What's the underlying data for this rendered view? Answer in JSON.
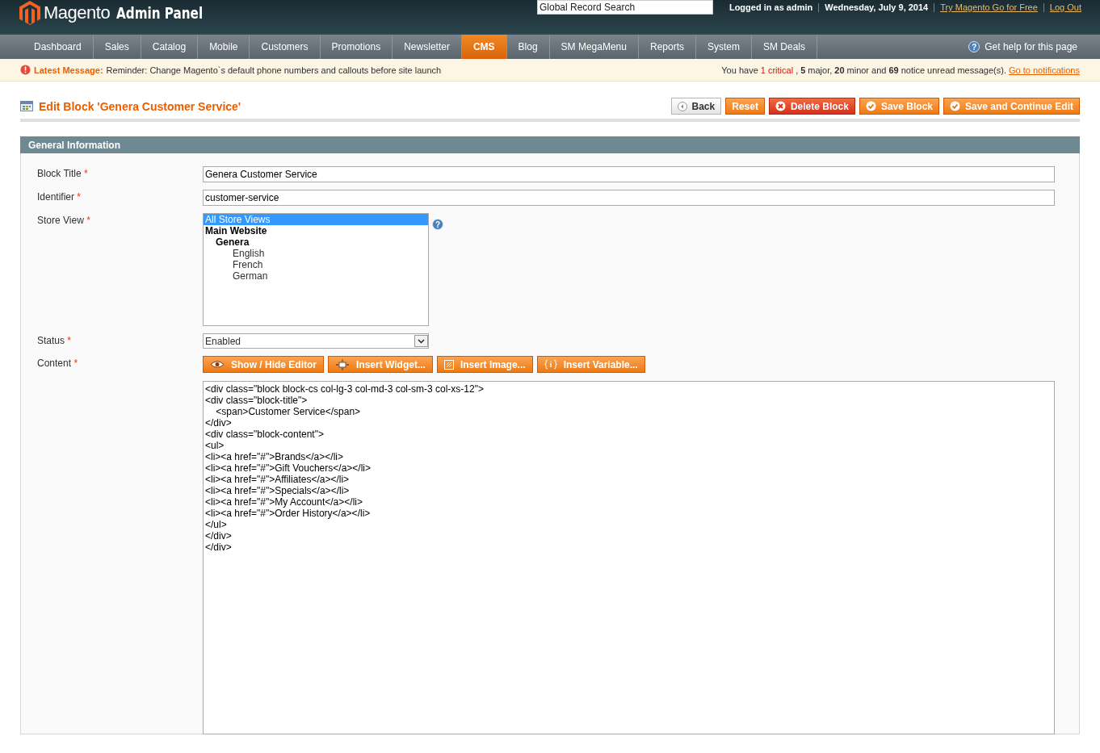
{
  "header": {
    "logo": "Magento",
    "logo_sub": "Admin Panel",
    "search": {
      "placeholder": "Global Record Search"
    },
    "user": "Logged in as admin",
    "date": "Wednesday, July 9, 2014",
    "links": [
      "Try Magento Go for Free",
      "Log Out"
    ]
  },
  "help_glyph": "?",
  "required_mark": "*",
  "nav": {
    "items": [
      {
        "label": "Dashboard",
        "selected": false
      },
      {
        "label": "Sales",
        "selected": false
      },
      {
        "label": "Catalog",
        "selected": false
      },
      {
        "label": "Mobile",
        "selected": false
      },
      {
        "label": "Customers",
        "selected": false
      },
      {
        "label": "Promotions",
        "selected": false
      },
      {
        "label": "Newsletter",
        "selected": false
      },
      {
        "label": "CMS",
        "selected": true
      },
      {
        "label": "Blog",
        "selected": false
      },
      {
        "label": "SM MegaMenu",
        "selected": false
      },
      {
        "label": "Reports",
        "selected": false
      },
      {
        "label": "System",
        "selected": false
      },
      {
        "label": "SM Deals",
        "selected": false
      }
    ],
    "help": "Get help for this page"
  },
  "message": {
    "label": "Latest Message:",
    "text": "Reminder: Change Magento`s default phone numbers and callouts before site launch",
    "summary": [
      {
        "kind": "plain",
        "text": "You have"
      },
      {
        "kind": "critical",
        "text": "1 critical"
      },
      {
        "kind": "plain",
        "text": ", "
      },
      {
        "kind": "bold",
        "text": "5"
      },
      {
        "kind": "plain",
        "text": "major,"
      },
      {
        "kind": "bold",
        "text": "20"
      },
      {
        "kind": "plain",
        "text": "minor and"
      },
      {
        "kind": "bold",
        "text": "69"
      },
      {
        "kind": "plain",
        "text": "notice unread message(s)."
      }
    ],
    "link": "Go to notifications"
  },
  "page": {
    "title": "Edit Block 'Genera Customer Service'",
    "buttons": [
      {
        "kind": "back",
        "label": "Back"
      },
      {
        "kind": "reset",
        "label": "Reset"
      },
      {
        "kind": "delete",
        "label": "Delete Block"
      },
      {
        "kind": "save",
        "label": "Save Block"
      },
      {
        "kind": "save",
        "label": "Save and Continue Edit"
      }
    ]
  },
  "section": {
    "title": "General Information",
    "block_title": {
      "label": "Block Title",
      "required": true,
      "value": "Genera Customer Service"
    },
    "identifier": {
      "label": "Identifier",
      "required": true,
      "value": "customer-service"
    },
    "store_view": {
      "label": "Store View",
      "required": true,
      "options": [
        {
          "label": "All Store Views",
          "selected": true
        },
        {
          "label": "Main Website",
          "selected": false,
          "children": [
            {
              "label": "Genera",
              "selected": false,
              "children": [
                {
                  "label": "English",
                  "selected": false
                },
                {
                  "label": "French",
                  "selected": false
                },
                {
                  "label": "German",
                  "selected": false
                }
              ]
            }
          ]
        }
      ]
    },
    "status": {
      "label": "Status",
      "required": true,
      "value": "Enabled"
    },
    "content": {
      "label": "Content",
      "required": true,
      "buttons": [
        {
          "kind": "editor",
          "label": "Show / Hide Editor"
        },
        {
          "kind": "widget",
          "label": "Insert Widget..."
        },
        {
          "kind": "image",
          "label": "Insert Image..."
        },
        {
          "kind": "variable",
          "label": "Insert Variable..."
        }
      ],
      "value": "<div class=\"block block-cs col-lg-3 col-md-3 col-sm-3 col-xs-12\">\n<div class=\"block-title\">\n\t<span>Customer Service</span>\n</div>\n<div class=\"block-content\">\n<ul>\n<li><a href=\"#\">Brands</a></li>\n<li><a href=\"#\">Gift Vouchers</a></li>\n<li><a href=\"#\">Affiliates</a></li>\n<li><a href=\"#\">Specials</a></li>\n<li><a href=\"#\">My Account</a></li>\n<li><a href=\"#\">Order History</a></li>\n</ul>\n</div>\n</div>"
    }
  }
}
